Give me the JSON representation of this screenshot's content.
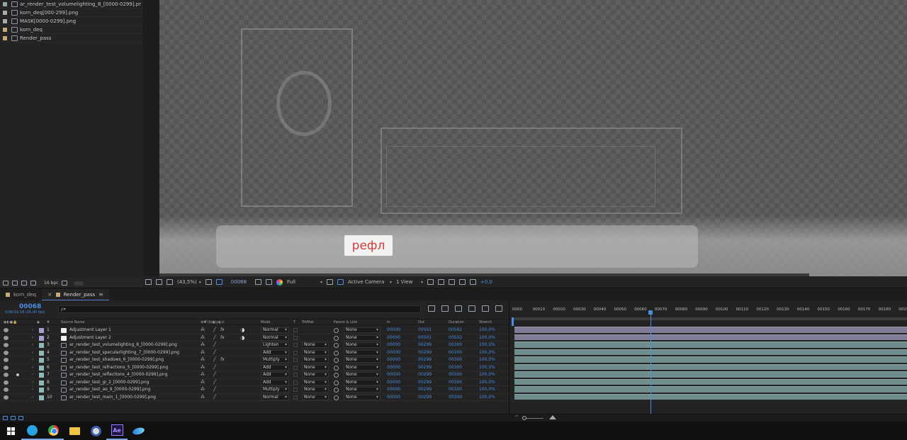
{
  "project": {
    "items": [
      {
        "name": "ar_render_test_volumelighting_8_[0000-0299].pr",
        "color": "#8fa6a6",
        "icon": "footage-icon"
      },
      {
        "name": "korn_deq[000-299].png",
        "color": "#a9a9a9",
        "icon": "footage-icon"
      },
      {
        "name": "MASK[0000-0299].png",
        "color": "#a9a9a9",
        "icon": "footage-icon"
      },
      {
        "name": "korn_deq",
        "color": "#c8a87a",
        "icon": "composition-icon"
      },
      {
        "name": "Render_pass",
        "color": "#c8a87a",
        "icon": "composition-icon"
      }
    ],
    "bpc": "16 bpc"
  },
  "viewer": {
    "overlay_text": "рефл",
    "zoom": "(43,5%)",
    "frame": "00068",
    "resolution": "Full",
    "camera": "Active Camera",
    "views": "1 View",
    "exposure": "+0,0"
  },
  "timeline": {
    "tabs": [
      {
        "label": "korn_deq",
        "color": "#c8a87a"
      },
      {
        "label": "Render_pass",
        "color": "#c8a87a"
      }
    ],
    "timecode": "00068",
    "timecode_sub": "0:00:02:18 (25.00 fps)",
    "search_placeholder": "ρ▾",
    "columns": {
      "num": "#",
      "source": "Source Name",
      "mode": "Mode",
      "t": "T",
      "trkmat": "TrkMat",
      "parent": "Parent & Link",
      "in": "In",
      "out": "Out",
      "duration": "Duration",
      "stretch": "Stretch"
    },
    "layers": [
      {
        "num": "1",
        "name": "Adjustment Layer 1",
        "type": "adjustment",
        "label": "#a79fd2",
        "mode": "Normal",
        "trkmat": "",
        "parent": "None",
        "in": "00000",
        "out": "00501",
        "dur": "00502",
        "str": "100,0%",
        "fx": true,
        "eye": true,
        "solo": false
      },
      {
        "num": "2",
        "name": "Adjustment Layer 2",
        "type": "adjustment",
        "label": "#a79fd2",
        "mode": "Normal",
        "trkmat": "",
        "parent": "None",
        "in": "00000",
        "out": "00501",
        "dur": "00502",
        "str": "100,0%",
        "fx": true,
        "eye": true,
        "solo": false
      },
      {
        "num": "3",
        "name": "ar_render_test_volumelighting_8_[0000-0299].png",
        "type": "footage",
        "label": "#8fb8b8",
        "mode": "Lighten",
        "trkmat": "None",
        "parent": "None",
        "in": "00000",
        "out": "00299",
        "dur": "00300",
        "str": "100,0%",
        "fx": false,
        "eye": true,
        "solo": false
      },
      {
        "num": "4",
        "name": "ar_render_test_specularlighting_7_[0000-0299].png",
        "type": "footage",
        "label": "#8fb8b8",
        "mode": "Add",
        "trkmat": "None",
        "parent": "None",
        "in": "00000",
        "out": "00299",
        "dur": "00300",
        "str": "100,0%",
        "fx": false,
        "eye": true,
        "solo": false
      },
      {
        "num": "5",
        "name": "ar_render_test_shadows_6_[0000-0299].png",
        "type": "footage",
        "label": "#8fb8b8",
        "mode": "Multiply",
        "trkmat": "None",
        "parent": "None",
        "in": "00000",
        "out": "00299",
        "dur": "00300",
        "str": "100,0%",
        "fx": true,
        "eye": true,
        "solo": false
      },
      {
        "num": "6",
        "name": "ar_render_test_refractions_5_[0000-0299].png",
        "type": "footage",
        "label": "#8fb8b8",
        "mode": "Add",
        "trkmat": "None",
        "parent": "None",
        "in": "00000",
        "out": "00299",
        "dur": "00300",
        "str": "100,0%",
        "fx": false,
        "eye": true,
        "solo": false
      },
      {
        "num": "7",
        "name": "ar_render_test_reflections_4_[0000-0299].png",
        "type": "footage",
        "label": "#8fb8b8",
        "mode": "Add",
        "trkmat": "None",
        "parent": "None",
        "in": "00000",
        "out": "00299",
        "dur": "00300",
        "str": "100,0%",
        "fx": false,
        "eye": true,
        "solo": true
      },
      {
        "num": "8",
        "name": "ar_render_test_gi_2_[0000-0299].png",
        "type": "footage",
        "label": "#8fb8b8",
        "mode": "Add",
        "trkmat": "None",
        "parent": "None",
        "in": "00000",
        "out": "00299",
        "dur": "00300",
        "str": "100,0%",
        "fx": false,
        "eye": true,
        "solo": false
      },
      {
        "num": "9",
        "name": "ar_render_test_ao_9_[0000-0299].png",
        "type": "footage",
        "label": "#8fb8b8",
        "mode": "Multiply",
        "trkmat": "None",
        "parent": "None",
        "in": "00000",
        "out": "00299",
        "dur": "00300",
        "str": "100,0%",
        "fx": false,
        "eye": true,
        "solo": false
      },
      {
        "num": "10",
        "name": "ar_render_test_main_1_[0000-0299].png",
        "type": "footage",
        "label": "#8fb8b8",
        "mode": "Normal",
        "trkmat": "None",
        "parent": "None",
        "in": "00000",
        "out": "00299",
        "dur": "00300",
        "str": "100,0%",
        "fx": false,
        "eye": true,
        "solo": false
      }
    ],
    "ruler": [
      "0000",
      "00010",
      "00020",
      "00030",
      "00040",
      "00050",
      "00060",
      "00070",
      "00080",
      "00090",
      "00100",
      "00110",
      "00120",
      "00130",
      "00140",
      "00150",
      "00160",
      "00170",
      "00180",
      "00190"
    ],
    "current_frame": 68,
    "ruler_start": 0,
    "ruler_end": 195
  },
  "colors": {
    "accent": "#4b8de0",
    "adjustment_bar": "#7f7d96",
    "footage_bar": "#6e8d8c"
  },
  "taskbar": {
    "apps": [
      "windows-start-icon",
      "telegram-icon",
      "chrome-icon",
      "file-explorer-icon",
      "obs-icon",
      "after-effects-icon",
      "edge-icon"
    ],
    "ae_text": "Ae"
  }
}
